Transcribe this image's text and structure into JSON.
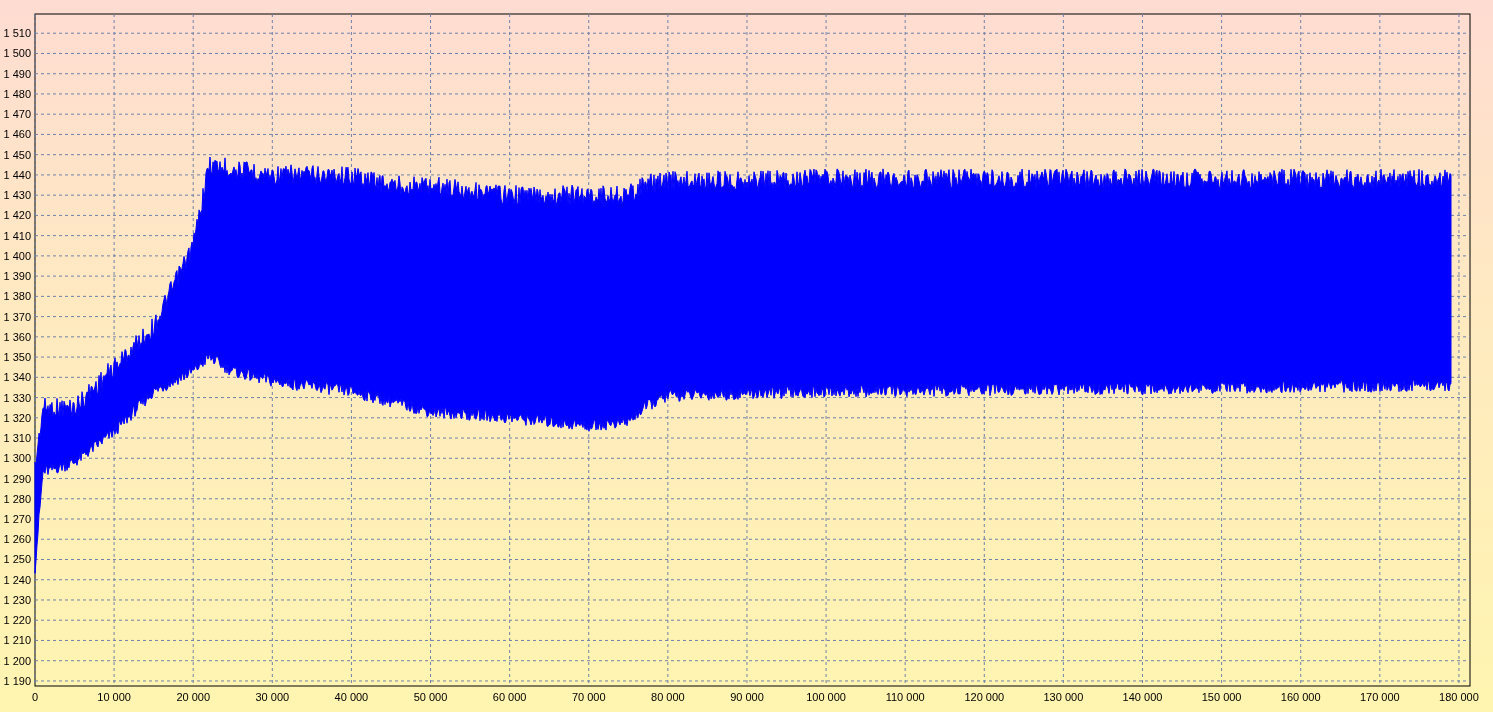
{
  "chart_data": {
    "type": "line",
    "grid": true,
    "xlim": [
      0,
      181400
    ],
    "ylim": [
      1187.5,
      1519.5
    ],
    "xticks": [
      {
        "value": 0,
        "label": "0"
      },
      {
        "value": 10000,
        "label": "10 000"
      },
      {
        "value": 20000,
        "label": "20 000"
      },
      {
        "value": 30000,
        "label": "30 000"
      },
      {
        "value": 40000,
        "label": "40 000"
      },
      {
        "value": 50000,
        "label": "50 000"
      },
      {
        "value": 60000,
        "label": "60 000"
      },
      {
        "value": 70000,
        "label": "70 000"
      },
      {
        "value": 80000,
        "label": "80 000"
      },
      {
        "value": 90000,
        "label": "90 000"
      },
      {
        "value": 100000,
        "label": "100 000"
      },
      {
        "value": 110000,
        "label": "110 000"
      },
      {
        "value": 120000,
        "label": "120 000"
      },
      {
        "value": 130000,
        "label": "130 000"
      },
      {
        "value": 140000,
        "label": "140 000"
      },
      {
        "value": 150000,
        "label": "150 000"
      },
      {
        "value": 160000,
        "label": "160 000"
      },
      {
        "value": 170000,
        "label": "170 000"
      },
      {
        "value": 180000,
        "label": "180 000"
      }
    ],
    "yticks": [
      {
        "value": 1190,
        "label": "1 190"
      },
      {
        "value": 1200,
        "label": "1 200"
      },
      {
        "value": 1210,
        "label": "1 210"
      },
      {
        "value": 1220,
        "label": "1 220"
      },
      {
        "value": 1230,
        "label": "1 230"
      },
      {
        "value": 1240,
        "label": "1 240"
      },
      {
        "value": 1250,
        "label": "1 250"
      },
      {
        "value": 1260,
        "label": "1 260"
      },
      {
        "value": 1270,
        "label": "1 270"
      },
      {
        "value": 1280,
        "label": "1 280"
      },
      {
        "value": 1290,
        "label": "1 290"
      },
      {
        "value": 1300,
        "label": "1 300"
      },
      {
        "value": 1310,
        "label": "1 310"
      },
      {
        "value": 1320,
        "label": "1 320"
      },
      {
        "value": 1330,
        "label": "1 330"
      },
      {
        "value": 1340,
        "label": "1 340"
      },
      {
        "value": 1350,
        "label": "1 350"
      },
      {
        "value": 1360,
        "label": "1 360"
      },
      {
        "value": 1370,
        "label": "1 370"
      },
      {
        "value": 1380,
        "label": "1 380"
      },
      {
        "value": 1390,
        "label": "1 390"
      },
      {
        "value": 1400,
        "label": "1 400"
      },
      {
        "value": 1410,
        "label": "1 410"
      },
      {
        "value": 1420,
        "label": "1 420"
      },
      {
        "value": 1430,
        "label": "1 430"
      },
      {
        "value": 1440,
        "label": "1 440"
      },
      {
        "value": 1450,
        "label": "1 450"
      },
      {
        "value": 1460,
        "label": "1 460"
      },
      {
        "value": 1470,
        "label": "1 470"
      },
      {
        "value": 1480,
        "label": "1 480"
      },
      {
        "value": 1490,
        "label": "1 490"
      },
      {
        "value": 1500,
        "label": "1 500"
      },
      {
        "value": 1510,
        "label": "1 510"
      }
    ]
  }
}
